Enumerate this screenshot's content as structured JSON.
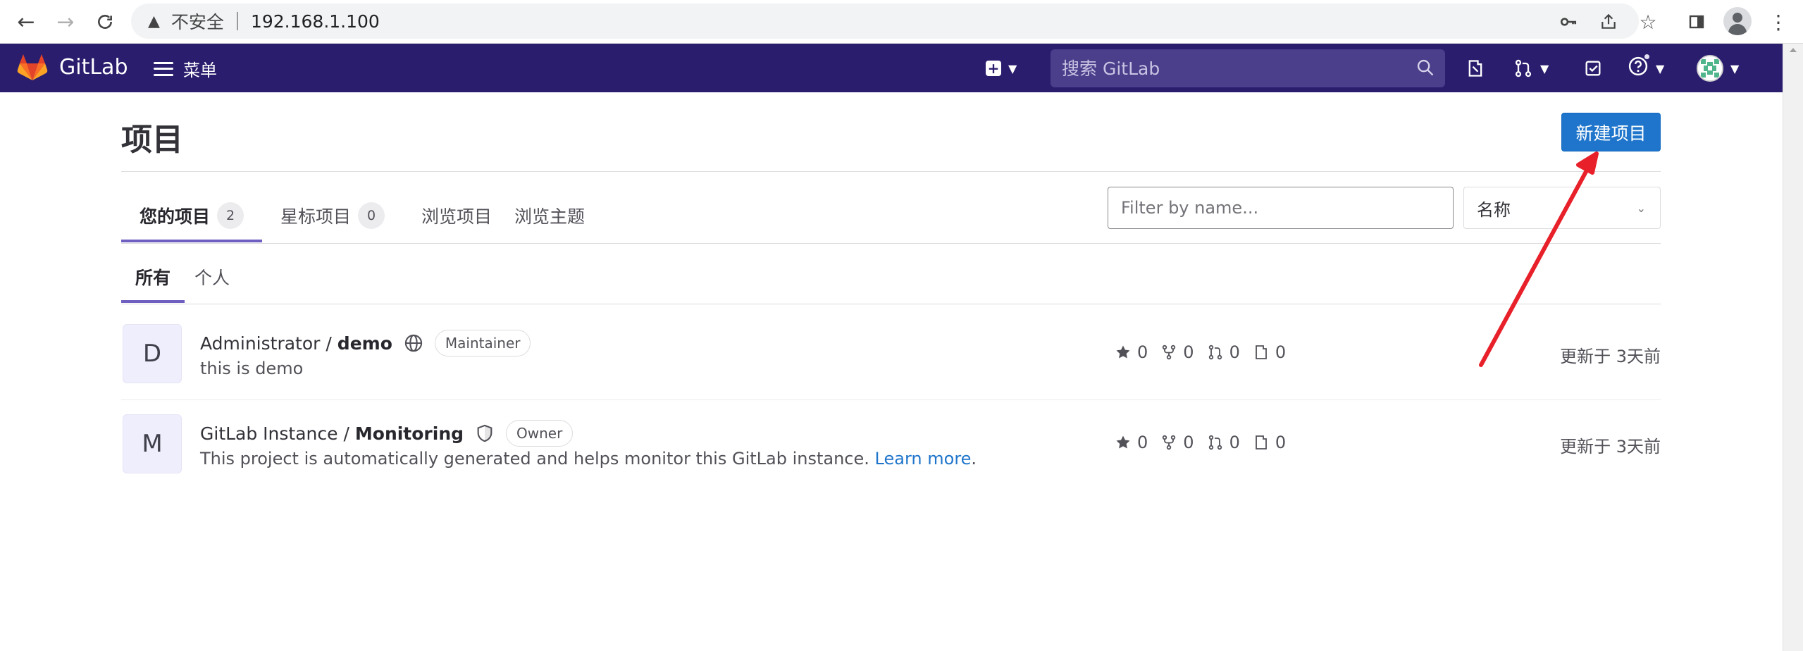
{
  "browser": {
    "insecure_label": "不安全",
    "url": "192.168.1.100"
  },
  "header": {
    "brand": "GitLab",
    "menu_label": "菜单",
    "search_placeholder": "搜索 GitLab",
    "accent_color": "#2b1d6e"
  },
  "page": {
    "title": "项目",
    "new_project_label": "新建项目"
  },
  "tabs": [
    {
      "label": "您的项目",
      "count": "2"
    },
    {
      "label": "星标项目",
      "count": "0"
    },
    {
      "label": "浏览项目"
    },
    {
      "label": "浏览主题"
    }
  ],
  "filter": {
    "placeholder": "Filter by name...",
    "sort_value": "名称"
  },
  "subtabs": [
    {
      "label": "所有"
    },
    {
      "label": "个人"
    }
  ],
  "projects": [
    {
      "avatar_letter": "D",
      "namespace": "Administrator /",
      "name": "demo",
      "visibility_icon": "globe-icon",
      "role": "Maintainer",
      "description": "this is demo",
      "stars": "0",
      "forks": "0",
      "merge_requests": "0",
      "issues": "0",
      "updated": "更新于 3天前"
    },
    {
      "avatar_letter": "M",
      "namespace": "GitLab Instance /",
      "name": "Monitoring",
      "visibility_icon": "shield-icon",
      "role": "Owner",
      "description": "This project is automatically generated and helps monitor this GitLab instance.",
      "learn_more": "Learn more",
      "period": ".",
      "stars": "0",
      "forks": "0",
      "merge_requests": "0",
      "issues": "0",
      "updated": "更新于 3天前"
    }
  ]
}
